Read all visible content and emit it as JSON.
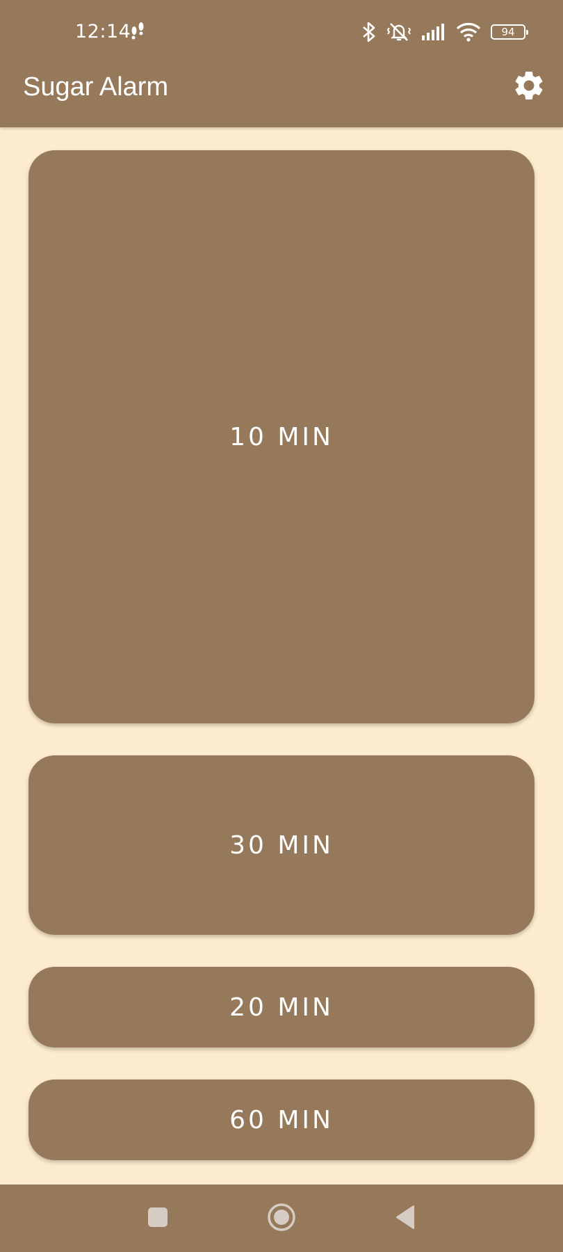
{
  "status_bar": {
    "time": "12:14",
    "battery_level": "94",
    "icons": [
      "footsteps-icon",
      "bluetooth-icon",
      "vibrate-mute-icon",
      "signal-icon",
      "wifi-icon",
      "battery-icon"
    ]
  },
  "app_bar": {
    "title": "Sugar Alarm",
    "settings_icon": "gear-icon"
  },
  "timers": [
    {
      "label": "10 MIN"
    },
    {
      "label": "30 MIN"
    },
    {
      "label": "20 MIN"
    },
    {
      "label": "60 MIN"
    }
  ],
  "nav_bar": {
    "icons": [
      "recents-icon",
      "home-icon",
      "back-icon"
    ]
  },
  "colors": {
    "primary": "#96785A",
    "background": "#FCEBCC",
    "on_primary": "#FFFFFF",
    "nav_icon": "#D6CCC4"
  }
}
